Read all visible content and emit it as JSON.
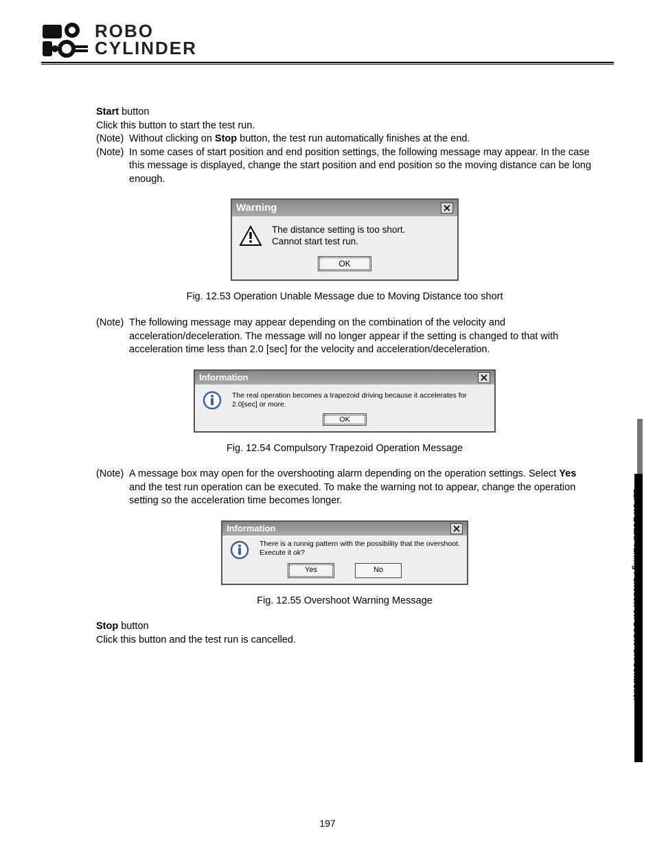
{
  "logo": {
    "line1": "ROBO",
    "line2": "CYLINDER"
  },
  "section1": {
    "title_bold": "Start",
    "title_rest": " button",
    "line1": "Click this button to start the test run.",
    "note1_label": "(Note)",
    "note1_body": "Without clicking on ",
    "note1_bold": "Stop",
    "note1_rest": " button, the test run automatically finishes at the end.",
    "note2_label": "(Note)",
    "note2_body": "In some cases of start position and end position settings, the following message may appear. In the case this message is displayed, change the start position and end position so the moving distance can be long enough."
  },
  "dlg1": {
    "title": "Warning",
    "message": "The distance setting is too short.\nCannot start test run.",
    "ok": "OK"
  },
  "caption1": "Fig. 12.53 Operation Unable Message due to Moving Distance too short",
  "para2_label": "(Note)",
  "para2_body": "The following message may appear depending on the combination of the velocity and acceleration/deceleration. The message will no longer appear if the setting is changed to that with acceleration time less than 2.0 [sec] for the velocity and acceleration/deceleration.",
  "dlg2": {
    "title": "Information",
    "message": "The real operation becomes a trapezoid driving because it accelerates for 2.0[sec] or more.",
    "ok": "OK"
  },
  "caption2": "Fig. 12.54 Compulsory Trapezoid Operation Message",
  "para3_label": "(Note)",
  "para3_body_a": "A message box may open for the overshooting alarm depending on the operation settings. Select ",
  "para3_bold": "Yes",
  "para3_body_b": " and the test run operation can be executed. To make the warning not to appear, change the operation setting so the acceleration time becomes longer.",
  "dlg3": {
    "title": "Information",
    "message": "There is a runnig pattern with the possibility that the overshoot.\nExecute it ok?",
    "yes": "Yes",
    "no": "No"
  },
  "caption3": "Fig. 12.55 Overshoot Warning Message",
  "section2": {
    "title_bold": "Stop",
    "title_rest": " button",
    "line1": "Click this button and the test run is cancelled."
  },
  "side_tab": "12. Off Board Tuning Function on SCON-CA Controller",
  "page_number": "197"
}
